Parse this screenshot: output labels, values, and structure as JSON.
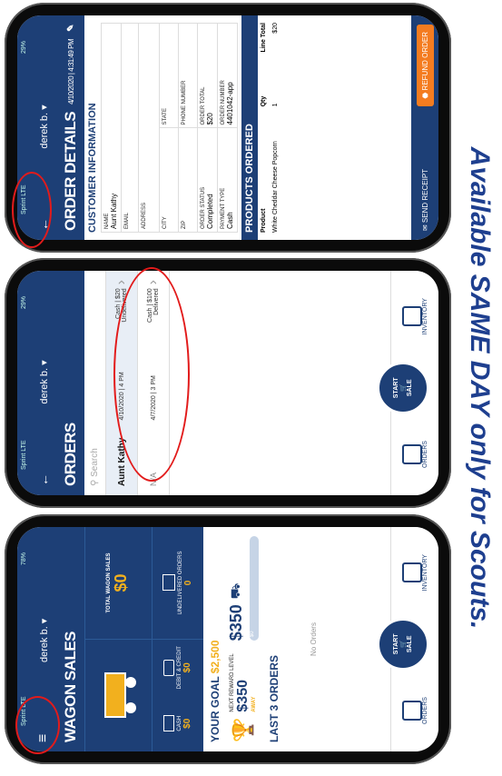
{
  "banner": "Available SAME DAY only for Scouts.",
  "status": {
    "carrier": "Sprint LTE",
    "battery1": "78%",
    "battery2": "29%",
    "battery3": "29%"
  },
  "user": "derek b. ▾",
  "s1": {
    "title": "WAGON SALES",
    "total_label": "TOTAL WAGON SALES",
    "total_value": "$0",
    "cash_label": "CASH",
    "cash_value": "$0",
    "debit_label": "DEBIT & CREDIT",
    "debit_value": "$0",
    "undelivered_label": "UNDELIVERED ORDERS",
    "undelivered_value": "0",
    "goal_label": "YOUR GOAL",
    "goal_value": "$2,500",
    "reward_label": "NEXT REWARD LEVEL",
    "reward_value": "$350",
    "reward_away": "AWAY",
    "prize_value": "$350",
    "progress_text": "$0",
    "last3": "LAST 3 ORDERS",
    "no_orders": "No Orders"
  },
  "nav": {
    "orders": "ORDERS",
    "start": "START",
    "sale": "SALE",
    "inventory": "INVENTORY"
  },
  "s2": {
    "title": "ORDERS",
    "search": "Search",
    "rows": [
      {
        "name": "Aunt Kathy",
        "date": "4/10/2020 | 4 PM",
        "pay": "Cash | $20",
        "status": "Undelivered"
      },
      {
        "name": "N/A",
        "date": "4/7/2020 | 3 PM",
        "pay": "Cash | $100",
        "status": "Delivered"
      }
    ]
  },
  "s3": {
    "title": "ORDER DETAILS",
    "datetime": "4/10/2020 | 4:31:49 PM",
    "cust": "CUSTOMER INFORMATION",
    "name_label": "NAME",
    "name_value": "Aunt Kathy",
    "email_label": "EMAIL",
    "address_label": "ADDRESS",
    "city_label": "CITY",
    "state_label": "STATE",
    "zip_label": "ZIP",
    "phone_label": "PHONE NUMBER",
    "ostatus_label": "ORDER STATUS",
    "ostatus_value": "Completed",
    "ototal_label": "ORDER TOTAL",
    "ototal_value": "$20",
    "ptype_label": "PAYMENT TYPE",
    "ptype_value": "Cash",
    "onum_label": "ORDER NUMBER",
    "onum_value": "4401042-app",
    "prod": "PRODUCTS ORDERED",
    "h_product": "Product",
    "h_qty": "Qty",
    "h_total": "Line Total",
    "p_name": "White Cheddar Cheese Popcorn",
    "p_qty": "1",
    "p_total": "$20",
    "send": "SEND RECEIPT",
    "refund": "REFUND ORDER"
  },
  "colors": {
    "navy": "#1d3f76",
    "gold": "#f2b01e",
    "red": "#e21b1b",
    "orange": "#f47c20"
  }
}
